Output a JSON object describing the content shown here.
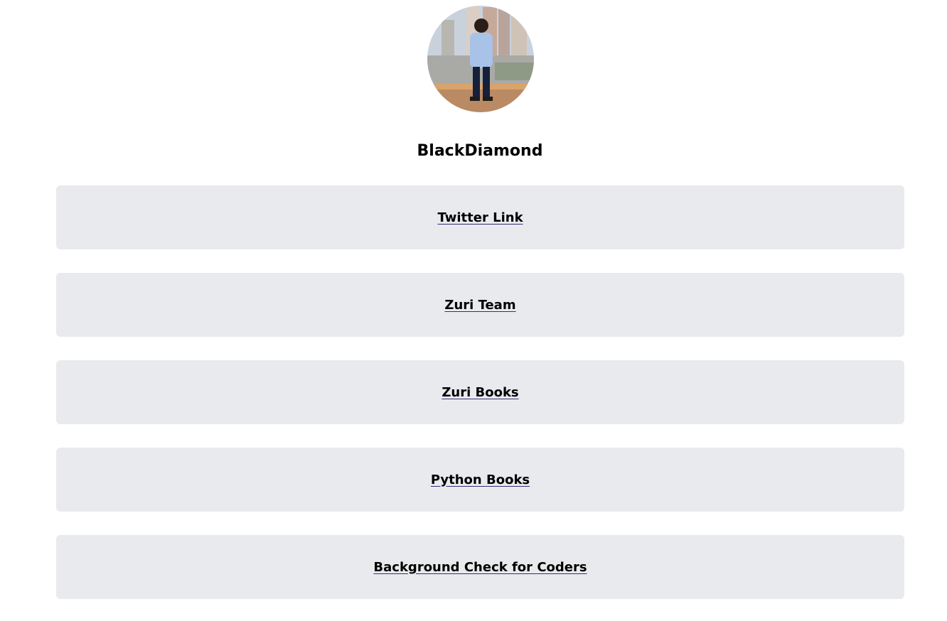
{
  "profile": {
    "name": "BlackDiamond",
    "avatar_icon": "profile-photo"
  },
  "links": [
    {
      "label": "Twitter Link"
    },
    {
      "label": "Zuri Team"
    },
    {
      "label": "Zuri Books"
    },
    {
      "label": "Python Books"
    },
    {
      "label": "Background Check for Coders"
    }
  ],
  "colors": {
    "card_bg": "#e9eaee",
    "text": "#000000"
  }
}
